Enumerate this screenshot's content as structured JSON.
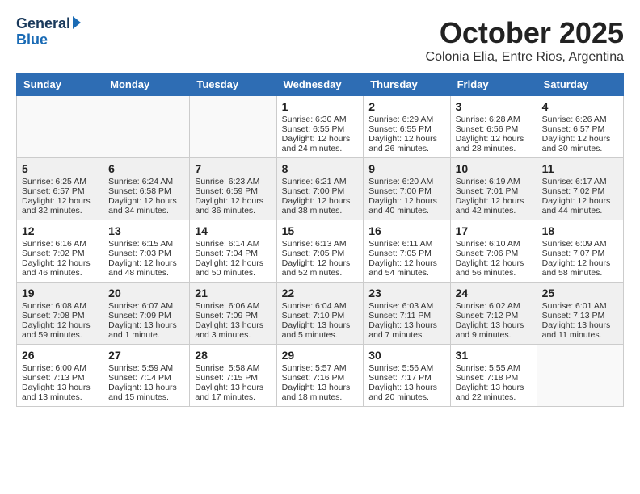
{
  "header": {
    "logo_line1": "General",
    "logo_line2": "Blue",
    "title": "October 2025",
    "subtitle": "Colonia Elia, Entre Rios, Argentina"
  },
  "days_of_week": [
    "Sunday",
    "Monday",
    "Tuesday",
    "Wednesday",
    "Thursday",
    "Friday",
    "Saturday"
  ],
  "weeks": [
    {
      "shaded": false,
      "days": [
        {
          "num": "",
          "lines": []
        },
        {
          "num": "",
          "lines": []
        },
        {
          "num": "",
          "lines": []
        },
        {
          "num": "1",
          "lines": [
            "Sunrise: 6:30 AM",
            "Sunset: 6:55 PM",
            "Daylight: 12 hours",
            "and 24 minutes."
          ]
        },
        {
          "num": "2",
          "lines": [
            "Sunrise: 6:29 AM",
            "Sunset: 6:55 PM",
            "Daylight: 12 hours",
            "and 26 minutes."
          ]
        },
        {
          "num": "3",
          "lines": [
            "Sunrise: 6:28 AM",
            "Sunset: 6:56 PM",
            "Daylight: 12 hours",
            "and 28 minutes."
          ]
        },
        {
          "num": "4",
          "lines": [
            "Sunrise: 6:26 AM",
            "Sunset: 6:57 PM",
            "Daylight: 12 hours",
            "and 30 minutes."
          ]
        }
      ]
    },
    {
      "shaded": true,
      "days": [
        {
          "num": "5",
          "lines": [
            "Sunrise: 6:25 AM",
            "Sunset: 6:57 PM",
            "Daylight: 12 hours",
            "and 32 minutes."
          ]
        },
        {
          "num": "6",
          "lines": [
            "Sunrise: 6:24 AM",
            "Sunset: 6:58 PM",
            "Daylight: 12 hours",
            "and 34 minutes."
          ]
        },
        {
          "num": "7",
          "lines": [
            "Sunrise: 6:23 AM",
            "Sunset: 6:59 PM",
            "Daylight: 12 hours",
            "and 36 minutes."
          ]
        },
        {
          "num": "8",
          "lines": [
            "Sunrise: 6:21 AM",
            "Sunset: 7:00 PM",
            "Daylight: 12 hours",
            "and 38 minutes."
          ]
        },
        {
          "num": "9",
          "lines": [
            "Sunrise: 6:20 AM",
            "Sunset: 7:00 PM",
            "Daylight: 12 hours",
            "and 40 minutes."
          ]
        },
        {
          "num": "10",
          "lines": [
            "Sunrise: 6:19 AM",
            "Sunset: 7:01 PM",
            "Daylight: 12 hours",
            "and 42 minutes."
          ]
        },
        {
          "num": "11",
          "lines": [
            "Sunrise: 6:17 AM",
            "Sunset: 7:02 PM",
            "Daylight: 12 hours",
            "and 44 minutes."
          ]
        }
      ]
    },
    {
      "shaded": false,
      "days": [
        {
          "num": "12",
          "lines": [
            "Sunrise: 6:16 AM",
            "Sunset: 7:02 PM",
            "Daylight: 12 hours",
            "and 46 minutes."
          ]
        },
        {
          "num": "13",
          "lines": [
            "Sunrise: 6:15 AM",
            "Sunset: 7:03 PM",
            "Daylight: 12 hours",
            "and 48 minutes."
          ]
        },
        {
          "num": "14",
          "lines": [
            "Sunrise: 6:14 AM",
            "Sunset: 7:04 PM",
            "Daylight: 12 hours",
            "and 50 minutes."
          ]
        },
        {
          "num": "15",
          "lines": [
            "Sunrise: 6:13 AM",
            "Sunset: 7:05 PM",
            "Daylight: 12 hours",
            "and 52 minutes."
          ]
        },
        {
          "num": "16",
          "lines": [
            "Sunrise: 6:11 AM",
            "Sunset: 7:05 PM",
            "Daylight: 12 hours",
            "and 54 minutes."
          ]
        },
        {
          "num": "17",
          "lines": [
            "Sunrise: 6:10 AM",
            "Sunset: 7:06 PM",
            "Daylight: 12 hours",
            "and 56 minutes."
          ]
        },
        {
          "num": "18",
          "lines": [
            "Sunrise: 6:09 AM",
            "Sunset: 7:07 PM",
            "Daylight: 12 hours",
            "and 58 minutes."
          ]
        }
      ]
    },
    {
      "shaded": true,
      "days": [
        {
          "num": "19",
          "lines": [
            "Sunrise: 6:08 AM",
            "Sunset: 7:08 PM",
            "Daylight: 12 hours",
            "and 59 minutes."
          ]
        },
        {
          "num": "20",
          "lines": [
            "Sunrise: 6:07 AM",
            "Sunset: 7:09 PM",
            "Daylight: 13 hours",
            "and 1 minute."
          ]
        },
        {
          "num": "21",
          "lines": [
            "Sunrise: 6:06 AM",
            "Sunset: 7:09 PM",
            "Daylight: 13 hours",
            "and 3 minutes."
          ]
        },
        {
          "num": "22",
          "lines": [
            "Sunrise: 6:04 AM",
            "Sunset: 7:10 PM",
            "Daylight: 13 hours",
            "and 5 minutes."
          ]
        },
        {
          "num": "23",
          "lines": [
            "Sunrise: 6:03 AM",
            "Sunset: 7:11 PM",
            "Daylight: 13 hours",
            "and 7 minutes."
          ]
        },
        {
          "num": "24",
          "lines": [
            "Sunrise: 6:02 AM",
            "Sunset: 7:12 PM",
            "Daylight: 13 hours",
            "and 9 minutes."
          ]
        },
        {
          "num": "25",
          "lines": [
            "Sunrise: 6:01 AM",
            "Sunset: 7:13 PM",
            "Daylight: 13 hours",
            "and 11 minutes."
          ]
        }
      ]
    },
    {
      "shaded": false,
      "days": [
        {
          "num": "26",
          "lines": [
            "Sunrise: 6:00 AM",
            "Sunset: 7:13 PM",
            "Daylight: 13 hours",
            "and 13 minutes."
          ]
        },
        {
          "num": "27",
          "lines": [
            "Sunrise: 5:59 AM",
            "Sunset: 7:14 PM",
            "Daylight: 13 hours",
            "and 15 minutes."
          ]
        },
        {
          "num": "28",
          "lines": [
            "Sunrise: 5:58 AM",
            "Sunset: 7:15 PM",
            "Daylight: 13 hours",
            "and 17 minutes."
          ]
        },
        {
          "num": "29",
          "lines": [
            "Sunrise: 5:57 AM",
            "Sunset: 7:16 PM",
            "Daylight: 13 hours",
            "and 18 minutes."
          ]
        },
        {
          "num": "30",
          "lines": [
            "Sunrise: 5:56 AM",
            "Sunset: 7:17 PM",
            "Daylight: 13 hours",
            "and 20 minutes."
          ]
        },
        {
          "num": "31",
          "lines": [
            "Sunrise: 5:55 AM",
            "Sunset: 7:18 PM",
            "Daylight: 13 hours",
            "and 22 minutes."
          ]
        },
        {
          "num": "",
          "lines": []
        }
      ]
    }
  ]
}
